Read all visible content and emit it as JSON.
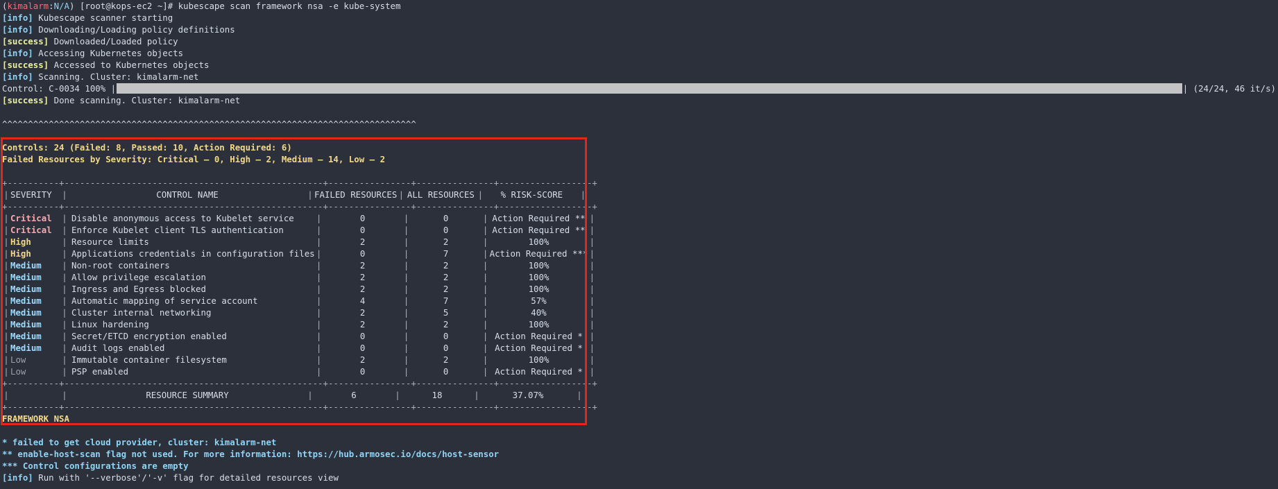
{
  "prompt": {
    "env": "kimalarm",
    "sep": ":",
    "na": "N/A",
    "host": "[root@kops-ec2 ~]#",
    "command": "kubescape scan framework nsa -e kube-system"
  },
  "log_lines": [
    {
      "tag": "[info]",
      "text": "Kubescape scanner starting",
      "kind": "info"
    },
    {
      "tag": "[info]",
      "text": "Downloading/Loading policy definitions",
      "kind": "info"
    },
    {
      "tag": "[success]",
      "text": "Downloaded/Loaded policy",
      "kind": "success"
    },
    {
      "tag": "[info]",
      "text": "Accessing Kubernetes objects",
      "kind": "info"
    },
    {
      "tag": "[success]",
      "text": "Accessed to Kubernetes objects",
      "kind": "success"
    },
    {
      "tag": "[info]",
      "text": "Scanning. Cluster: kimalarm-net",
      "kind": "info"
    }
  ],
  "progress": {
    "label": "Control: C-0034 100% |",
    "fraction": 1.0,
    "suffix": "| (24/24, 46 it/s)"
  },
  "done_line": {
    "tag": "[success]",
    "text": "Done scanning. Cluster: kimalarm-net"
  },
  "tilde_line": "^^^^^^^^^^^^^^^^^^^^^^^^^^^^^^^^^^^^^^^^^^^^^^^^^^^^^^^^^^^^^^^^^^^^^^^^^^^^^^^^",
  "summary": {
    "controls": "Controls: 24 (Failed: 8, Passed: 10, Action Required: 6)",
    "severity": "Failed Resources by Severity: Critical — 0, High — 2, Medium — 14, Low — 2"
  },
  "table": {
    "border": "+----------+--------------------------------------------------+----------------+---------------+------------------+",
    "headers": [
      "SEVERITY",
      "CONTROL NAME",
      "FAILED RESOURCES",
      "ALL RESOURCES",
      "% RISK-SCORE"
    ],
    "rows": [
      {
        "severity": "Critical",
        "level": "crit",
        "name": "Disable anonymous access to Kubelet service",
        "failed": "0",
        "all": "0",
        "risk": "Action Required **"
      },
      {
        "severity": "Critical",
        "level": "crit",
        "name": "Enforce Kubelet client TLS authentication",
        "failed": "0",
        "all": "0",
        "risk": "Action Required **"
      },
      {
        "severity": "High",
        "level": "high",
        "name": "Resource limits",
        "failed": "2",
        "all": "2",
        "risk": "100%"
      },
      {
        "severity": "High",
        "level": "high",
        "name": "Applications credentials in configuration files",
        "failed": "0",
        "all": "7",
        "risk": "Action Required ***"
      },
      {
        "severity": "Medium",
        "level": "med",
        "name": "Non-root containers",
        "failed": "2",
        "all": "2",
        "risk": "100%"
      },
      {
        "severity": "Medium",
        "level": "med",
        "name": "Allow privilege escalation",
        "failed": "2",
        "all": "2",
        "risk": "100%"
      },
      {
        "severity": "Medium",
        "level": "med",
        "name": "Ingress and Egress blocked",
        "failed": "2",
        "all": "2",
        "risk": "100%"
      },
      {
        "severity": "Medium",
        "level": "med",
        "name": "Automatic mapping of service account",
        "failed": "4",
        "all": "7",
        "risk": "57%"
      },
      {
        "severity": "Medium",
        "level": "med",
        "name": "Cluster internal networking",
        "failed": "2",
        "all": "5",
        "risk": "40%"
      },
      {
        "severity": "Medium",
        "level": "med",
        "name": "Linux hardening",
        "failed": "2",
        "all": "2",
        "risk": "100%"
      },
      {
        "severity": "Medium",
        "level": "med",
        "name": "Secret/ETCD encryption enabled",
        "failed": "0",
        "all": "0",
        "risk": "Action Required *"
      },
      {
        "severity": "Medium",
        "level": "med",
        "name": "Audit logs enabled",
        "failed": "0",
        "all": "0",
        "risk": "Action Required *"
      },
      {
        "severity": "Low",
        "level": "low",
        "name": "Immutable container filesystem",
        "failed": "2",
        "all": "2",
        "risk": "100%"
      },
      {
        "severity": "Low",
        "level": "low",
        "name": "PSP enabled",
        "failed": "0",
        "all": "0",
        "risk": "Action Required *"
      }
    ],
    "total": {
      "label": "RESOURCE SUMMARY",
      "failed": "6",
      "all": "18",
      "risk": "37.07%"
    }
  },
  "framework": "FRAMEWORK NSA",
  "footnotes": [
    "* failed to get cloud provider, cluster: kimalarm-net",
    "** enable-host-scan flag not used. For more information: https://hub.armosec.io/docs/host-sensor",
    "*** Control configurations are empty"
  ],
  "final_line": {
    "tag": "[info]",
    "text": "Run with '--verbose'/'-v' flag for detailed resources view"
  },
  "colors": {
    "background": "#2b303b",
    "highlight": "#e0281c",
    "critical": "#f8a8b0",
    "high": "#f2d98a",
    "medium": "#9cdcfe",
    "low": "#9aa0a8"
  }
}
